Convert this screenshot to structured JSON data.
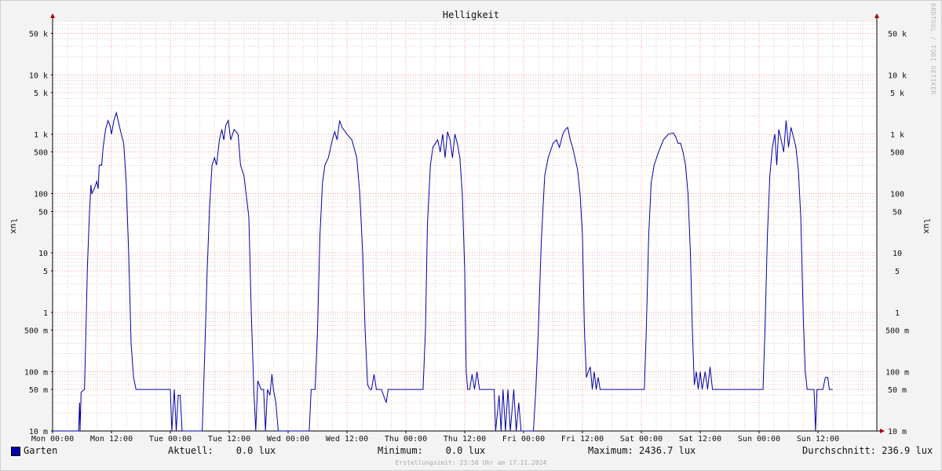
{
  "credit": "RRDTOOL / TOBI OETIKER",
  "legend": {
    "series_label": "Garten",
    "current": "Aktuell:    0.0 lux",
    "minimum": "Minimum:    0.0 lux",
    "maximum": "Maximum: 2436.7 lux",
    "average": "Durchschnitt: 236.9 lux"
  },
  "footer": "Erstellungszeit: 23:58 Uhr am 17.11.2024",
  "colors": {
    "line": "#0000aa",
    "major_grid": "#ff9999",
    "minor_grid": "#e0c8c8",
    "plot_bg": "#ffffff"
  },
  "chart_data": {
    "type": "line",
    "title": "Helligkeit",
    "ylabel": "lux",
    "yscale": "log",
    "ylim": [
      0.01,
      80000
    ],
    "y_ticks": [
      {
        "value": 50000,
        "label": "50 k"
      },
      {
        "value": 10000,
        "label": "10 k"
      },
      {
        "value": 5000,
        "label": "5 k"
      },
      {
        "value": 1000,
        "label": "1 k"
      },
      {
        "value": 500,
        "label": "500"
      },
      {
        "value": 100,
        "label": "100"
      },
      {
        "value": 50,
        "label": "50"
      },
      {
        "value": 10,
        "label": "10"
      },
      {
        "value": 5,
        "label": "5"
      },
      {
        "value": 1,
        "label": "1"
      },
      {
        "value": 0.5,
        "label": "500 m"
      },
      {
        "value": 0.1,
        "label": "100 m"
      },
      {
        "value": 0.05,
        "label": "50 m"
      },
      {
        "value": 0.01,
        "label": "10 m"
      }
    ],
    "x_unit": "hours since Mon 00:00",
    "xlim": [
      0,
      168
    ],
    "x_ticks": [
      {
        "value": 0,
        "label": "Mon 00:00"
      },
      {
        "value": 12,
        "label": "Mon 12:00"
      },
      {
        "value": 24,
        "label": "Tue 00:00"
      },
      {
        "value": 36,
        "label": "Tue 12:00"
      },
      {
        "value": 48,
        "label": "Wed 00:00"
      },
      {
        "value": 60,
        "label": "Wed 12:00"
      },
      {
        "value": 72,
        "label": "Thu 00:00"
      },
      {
        "value": 84,
        "label": "Thu 12:00"
      },
      {
        "value": 96,
        "label": "Fri 00:00"
      },
      {
        "value": 108,
        "label": "Fri 12:00"
      },
      {
        "value": 120,
        "label": "Sat 00:00"
      },
      {
        "value": 132,
        "label": "Sat 12:00"
      },
      {
        "value": 144,
        "label": "Sun 00:00"
      },
      {
        "value": 156,
        "label": "Sun 12:00"
      }
    ],
    "grid": true,
    "series": [
      {
        "name": "Garten",
        "points": [
          [
            0,
            0.01
          ],
          [
            5.3,
            0.01
          ],
          [
            5.5,
            0.03
          ],
          [
            5.6,
            0.01
          ],
          [
            5.8,
            0.045
          ],
          [
            6.5,
            0.05
          ],
          [
            6.8,
            0.5
          ],
          [
            7.1,
            6
          ],
          [
            7.5,
            45
          ],
          [
            7.8,
            140
          ],
          [
            8.0,
            100
          ],
          [
            8.5,
            120
          ],
          [
            9.0,
            160
          ],
          [
            9.3,
            120
          ],
          [
            9.5,
            300
          ],
          [
            10.0,
            300
          ],
          [
            10.3,
            600
          ],
          [
            10.8,
            1200
          ],
          [
            11.3,
            1700
          ],
          [
            11.7,
            1400
          ],
          [
            12.0,
            1000
          ],
          [
            12.5,
            1700
          ],
          [
            13.0,
            2300
          ],
          [
            13.5,
            1500
          ],
          [
            14.0,
            1000
          ],
          [
            14.5,
            700
          ],
          [
            15.0,
            150
          ],
          [
            15.5,
            10
          ],
          [
            16.0,
            0.3
          ],
          [
            16.5,
            0.08
          ],
          [
            17.0,
            0.05
          ],
          [
            18.0,
            0.05
          ],
          [
            20.0,
            0.05
          ],
          [
            22.0,
            0.05
          ],
          [
            24.0,
            0.05
          ],
          [
            24.3,
            0.01
          ],
          [
            24.8,
            0.05
          ],
          [
            25.2,
            0.01
          ],
          [
            25.6,
            0.04
          ],
          [
            26.0,
            0.04
          ],
          [
            26.4,
            0.01
          ],
          [
            30.5,
            0.01
          ],
          [
            31.0,
            0.2
          ],
          [
            31.5,
            5
          ],
          [
            32.0,
            60
          ],
          [
            32.5,
            300
          ],
          [
            33.0,
            400
          ],
          [
            33.4,
            300
          ],
          [
            34.0,
            800
          ],
          [
            34.5,
            1200
          ],
          [
            34.9,
            800
          ],
          [
            35.3,
            1400
          ],
          [
            35.8,
            1700
          ],
          [
            36.3,
            800
          ],
          [
            37.0,
            1200
          ],
          [
            37.8,
            1000
          ],
          [
            38.3,
            300
          ],
          [
            39.0,
            200
          ],
          [
            40.0,
            40
          ],
          [
            40.5,
            1
          ],
          [
            41.0,
            0.05
          ],
          [
            41.4,
            0.01
          ],
          [
            41.8,
            0.07
          ],
          [
            42.5,
            0.05
          ],
          [
            43.0,
            0.05
          ],
          [
            43.4,
            0.01
          ],
          [
            43.8,
            0.05
          ],
          [
            44.3,
            0.04
          ],
          [
            44.7,
            0.09
          ],
          [
            45.0,
            0.05
          ],
          [
            45.5,
            0.03
          ],
          [
            46.0,
            0.01
          ],
          [
            52.3,
            0.01
          ],
          [
            52.7,
            0.05
          ],
          [
            53.5,
            0.05
          ],
          [
            54.0,
            0.5
          ],
          [
            54.5,
            20
          ],
          [
            55.0,
            150
          ],
          [
            55.5,
            300
          ],
          [
            56.2,
            400
          ],
          [
            57.0,
            800
          ],
          [
            57.5,
            1100
          ],
          [
            58.0,
            800
          ],
          [
            58.5,
            1700
          ],
          [
            59.0,
            1300
          ],
          [
            60.0,
            1000
          ],
          [
            61.0,
            800
          ],
          [
            62.0,
            400
          ],
          [
            62.6,
            100
          ],
          [
            63.2,
            10
          ],
          [
            63.7,
            0.5
          ],
          [
            64.2,
            0.06
          ],
          [
            64.7,
            0.05
          ],
          [
            65.0,
            0.05
          ],
          [
            65.5,
            0.09
          ],
          [
            66.0,
            0.05
          ],
          [
            67.0,
            0.05
          ],
          [
            68.0,
            0.03
          ],
          [
            68.4,
            0.05
          ],
          [
            70.0,
            0.05
          ],
          [
            72.0,
            0.05
          ],
          [
            74.0,
            0.05
          ],
          [
            75.5,
            0.05
          ],
          [
            76.0,
            0.5
          ],
          [
            76.4,
            30
          ],
          [
            77.0,
            300
          ],
          [
            77.5,
            600
          ],
          [
            78.5,
            800
          ],
          [
            79.0,
            500
          ],
          [
            79.5,
            1000
          ],
          [
            80.0,
            400
          ],
          [
            80.5,
            1100
          ],
          [
            81.0,
            800
          ],
          [
            81.5,
            400
          ],
          [
            82.0,
            1000
          ],
          [
            82.5,
            700
          ],
          [
            83.0,
            400
          ],
          [
            83.5,
            100
          ],
          [
            84.0,
            5
          ],
          [
            84.3,
            0.1
          ],
          [
            84.6,
            0.05
          ],
          [
            85.0,
            0.05
          ],
          [
            85.5,
            0.09
          ],
          [
            86.0,
            0.05
          ],
          [
            86.5,
            0.1
          ],
          [
            87.0,
            0.05
          ],
          [
            88.0,
            0.05
          ],
          [
            90.0,
            0.05
          ],
          [
            90.3,
            0.01
          ],
          [
            91.0,
            0.04
          ],
          [
            91.4,
            0.01
          ],
          [
            91.8,
            0.05
          ],
          [
            92.3,
            0.01
          ],
          [
            92.8,
            0.05
          ],
          [
            93.3,
            0.01
          ],
          [
            94.0,
            0.05
          ],
          [
            94.5,
            0.01
          ],
          [
            95.0,
            0.03
          ],
          [
            95.5,
            0.01
          ],
          [
            98.0,
            0.01
          ],
          [
            98.5,
            0.05
          ],
          [
            99.0,
            0.5
          ],
          [
            99.6,
            15
          ],
          [
            100.3,
            200
          ],
          [
            101.0,
            400
          ],
          [
            102.0,
            700
          ],
          [
            102.7,
            800
          ],
          [
            103.3,
            600
          ],
          [
            104.0,
            1000
          ],
          [
            104.5,
            1200
          ],
          [
            105.0,
            1300
          ],
          [
            105.5,
            800
          ],
          [
            106.0,
            600
          ],
          [
            107.0,
            250
          ],
          [
            107.5,
            100
          ],
          [
            108.0,
            20
          ],
          [
            108.4,
            0.5
          ],
          [
            108.8,
            0.08
          ],
          [
            109.2,
            0.1
          ],
          [
            109.6,
            0.12
          ],
          [
            110.0,
            0.05
          ],
          [
            110.4,
            0.1
          ],
          [
            110.8,
            0.05
          ],
          [
            111.2,
            0.08
          ],
          [
            111.6,
            0.05
          ],
          [
            112.0,
            0.05
          ],
          [
            116.0,
            0.05
          ],
          [
            120.0,
            0.05
          ],
          [
            120.6,
            0.05
          ],
          [
            121.0,
            0.5
          ],
          [
            121.5,
            20
          ],
          [
            122.0,
            150
          ],
          [
            122.6,
            300
          ],
          [
            123.5,
            500
          ],
          [
            124.5,
            800
          ],
          [
            125.5,
            1000
          ],
          [
            126.5,
            1050
          ],
          [
            127.0,
            900
          ],
          [
            127.5,
            700
          ],
          [
            128.0,
            700
          ],
          [
            128.5,
            500
          ],
          [
            129.0,
            300
          ],
          [
            129.5,
            100
          ],
          [
            130.0,
            10
          ],
          [
            130.4,
            0.5
          ],
          [
            130.8,
            0.06
          ],
          [
            131.2,
            0.1
          ],
          [
            131.6,
            0.05
          ],
          [
            132.0,
            0.1
          ],
          [
            132.4,
            0.05
          ],
          [
            133.0,
            0.1
          ],
          [
            133.5,
            0.05
          ],
          [
            134.0,
            0.12
          ],
          [
            134.5,
            0.05
          ],
          [
            136.0,
            0.05
          ],
          [
            140.0,
            0.05
          ],
          [
            144.0,
            0.05
          ],
          [
            144.8,
            0.05
          ],
          [
            145.2,
            0.5
          ],
          [
            145.7,
            20
          ],
          [
            146.2,
            200
          ],
          [
            146.7,
            600
          ],
          [
            147.2,
            1000
          ],
          [
            147.6,
            300
          ],
          [
            148.0,
            1200
          ],
          [
            148.5,
            800
          ],
          [
            149.0,
            500
          ],
          [
            149.5,
            1700
          ],
          [
            150.0,
            600
          ],
          [
            150.5,
            1300
          ],
          [
            151.0,
            900
          ],
          [
            151.5,
            600
          ],
          [
            152.0,
            250
          ],
          [
            152.5,
            40
          ],
          [
            153.0,
            0.8
          ],
          [
            153.4,
            0.1
          ],
          [
            153.8,
            0.05
          ],
          [
            154.5,
            0.05
          ],
          [
            155.2,
            0.05
          ],
          [
            155.5,
            0.01
          ],
          [
            155.8,
            0.05
          ],
          [
            157.0,
            0.05
          ],
          [
            157.5,
            0.08
          ],
          [
            158.0,
            0.08
          ],
          [
            158.3,
            0.05
          ],
          [
            159.0,
            0.05
          ]
        ]
      }
    ]
  }
}
